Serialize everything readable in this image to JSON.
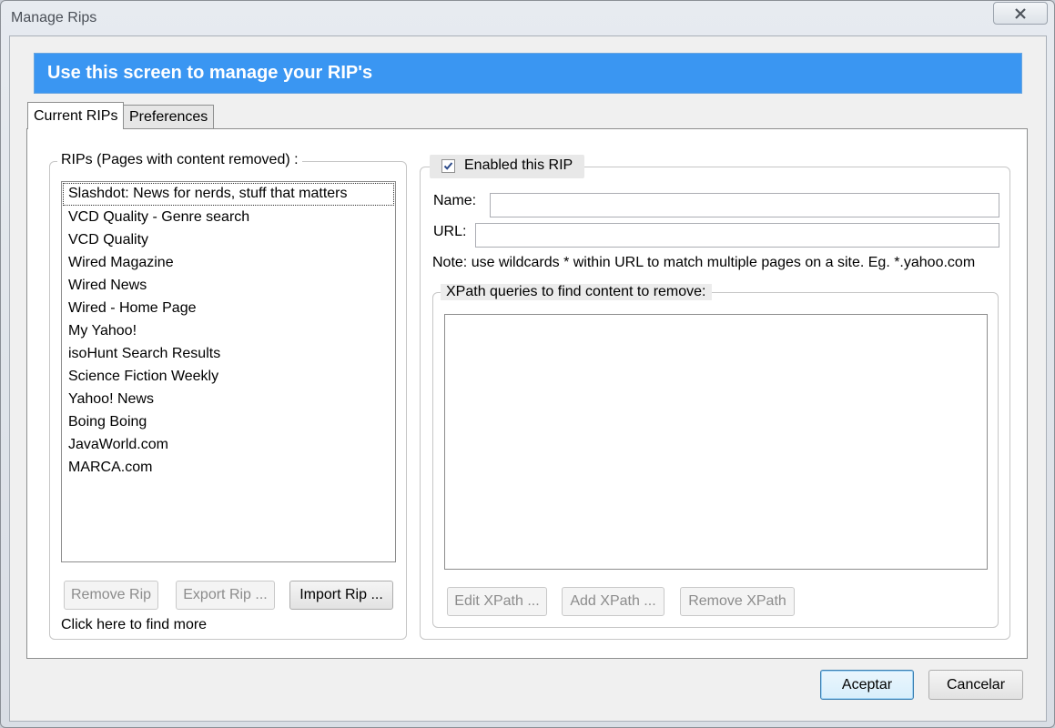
{
  "window": {
    "title": "Manage Rips"
  },
  "banner": {
    "text": "Use this screen to manage your RIP's"
  },
  "tabs": [
    {
      "label": "Current RIPs",
      "active": true
    },
    {
      "label": "Preferences",
      "active": false
    }
  ],
  "rips_group": {
    "caption": "RIPs (Pages with content removed) :",
    "items": [
      "Slashdot: News for nerds, stuff that matters",
      "VCD Quality - Genre search",
      "VCD Quality",
      "Wired Magazine",
      "Wired News",
      "Wired - Home Page",
      "My Yahoo!",
      "isoHunt Search Results",
      "Science Fiction Weekly",
      "Yahoo! News",
      "Boing Boing",
      "JavaWorld.com",
      "MARCA.com"
    ],
    "remove_button": "Remove Rip",
    "export_button": "Export Rip ...",
    "import_button": "Import Rip ...",
    "find_more_link": "Click here to find more"
  },
  "rip_details": {
    "enabled_label": "Enabled this RIP",
    "enabled_checked": true,
    "name_label": "Name:",
    "name_value": "",
    "url_label": "URL:",
    "url_value": "",
    "note": "Note: use wildcards * within URL to match multiple pages on a site. Eg. *.yahoo.com",
    "xpath_caption": "XPath queries to find content to remove:",
    "edit_xpath_button": "Edit XPath ...",
    "add_xpath_button": "Add XPath ...",
    "remove_xpath_button": "Remove XPath"
  },
  "footer": {
    "ok_button": "Aceptar",
    "cancel_button": "Cancelar"
  },
  "colors": {
    "banner": "#3a96f2",
    "banner_text": "#ffffff"
  }
}
